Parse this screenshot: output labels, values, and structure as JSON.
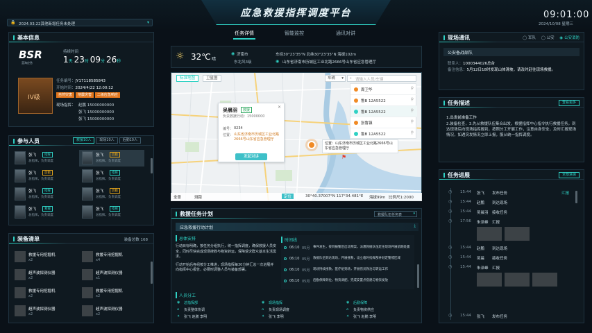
{
  "header": {
    "notice": "2024.03.22其他新增任务未处理",
    "title": "应急救援指挥调度平台",
    "time": "09:01:00",
    "date": "2024/10/08 星期三",
    "nav_tabs": [
      "任务详情",
      "智能监控",
      "通讯对讲"
    ]
  },
  "basic_info": {
    "title": "基本信息",
    "logo": "BSR",
    "logo_sub": "蓝海应急",
    "duration_label": "持续时间",
    "duration": {
      "d": "1",
      "d_unit": "天",
      "h": "23",
      "h_unit": "时",
      "m": "09",
      "m_unit": "分",
      "s": "26",
      "s_unit": "秒"
    },
    "level": "IV级",
    "task_id_label": "任务编号：",
    "task_id": "JY17118585843",
    "time_label": "开始时间：",
    "time_value": "2024/4/22 12:00:12",
    "tags": [
      "自然灾害",
      "地震灾害",
      "二级应急响应"
    ],
    "contact_label": "现场指挥：",
    "contacts": [
      "赵鹏 15000000000",
      "张飞 15000000000",
      "张飞 15000000000"
    ]
  },
  "personnel": {
    "title": "参与人员",
    "filters": [
      "救援10人",
      "现场10人",
      "后勤10人"
    ],
    "people": [
      {
        "name": "张飞",
        "tag": "指挥",
        "tag_color": "#2fd1c4",
        "desc": "总指挥，负责调度"
      },
      {
        "name": "张飞",
        "tag": "后勤",
        "tag_color": "#e0a21c",
        "desc": "总指挥，负责调度"
      },
      {
        "name": "张飞",
        "tag": "后勤",
        "tag_color": "#e0a21c",
        "desc": "总指挥，负责调度"
      },
      {
        "name": "张飞",
        "tag": "指挥",
        "tag_color": "#2fd1c4",
        "desc": "总指挥，负责调度"
      },
      {
        "name": "张飞",
        "tag": "指挥",
        "tag_color": "#2fd1c4",
        "desc": "总指挥，负责调度"
      },
      {
        "name": "张飞",
        "tag": "后勤",
        "tag_color": "#e0a21c",
        "desc": "总指挥，负责调度"
      },
      {
        "name": "张飞",
        "tag": "救援",
        "tag_color": "#2fd1c4",
        "desc": "总指挥，负责调度"
      },
      {
        "name": "张飞",
        "tag": "指挥",
        "tag_color": "#2fd1c4",
        "desc": "总指挥，负责调度"
      }
    ]
  },
  "equipment": {
    "title": "装备清单",
    "total_label": "装备总数 168",
    "items": [
      {
        "name": "救援专用挖掘机",
        "count": "x2"
      },
      {
        "name": "救援专用挖掘机",
        "count": "x4"
      },
      {
        "name": "超声波探测仪器",
        "count": "x2"
      },
      {
        "name": "超声波探测仪器",
        "count": "x1"
      },
      {
        "name": "救援专用挖掘机",
        "count": "x2"
      },
      {
        "name": "救援专用挖掘机",
        "count": "x2"
      },
      {
        "name": "超声波探测仪器",
        "count": "x2"
      },
      {
        "name": "超声波探测仪器",
        "count": "x2"
      }
    ]
  },
  "weather": {
    "temp": "32℃",
    "cond": "晴",
    "city": "济南市",
    "wind": "东北风3级",
    "coords": "东经30°23'35\"N  北纬30°23'35\"N  海拔102m",
    "address": "山东省济南市历城区工业北路2666号山东省应急管理厅"
  },
  "map": {
    "tabs": [
      "标准地图",
      "卫星图"
    ],
    "vehicle_label": "车辆",
    "search_placeholder": "请输入人员/车辆",
    "list": [
      {
        "name": "周卫华",
        "color": "#f08a24"
      },
      {
        "name": "鲁B 12A5522",
        "color": "#f08a24"
      },
      {
        "name": "鲁B 12A5522",
        "color": "#2fd1c4"
      },
      {
        "name": "张鲁镇",
        "color": "#f08a24"
      },
      {
        "name": "鲁B 12A5522",
        "color": "#2fd1c4"
      }
    ],
    "popup": {
      "name": "吴晨羽",
      "tag": "救援",
      "phone": "负责救援行动：15000000",
      "code_label": "编号：",
      "code": "0234",
      "loc_label": "位置：",
      "loc": "山东省济南市历城区工业北路2666号山东省应急管理厅",
      "btn": "发起对讲"
    },
    "label_box": "位置：山东济南市历城区工业北路2666号山东省应急管理厅",
    "bottom": {
      "all": "全景",
      "measure": "测距",
      "locate": "定位",
      "coord": "30°40.37007°N  117°34.481°E",
      "scale": "海拔99m",
      "zoom": "比例尺1:2000"
    }
  },
  "rescue_plan": {
    "title": "救援任务计划",
    "select": "救援队伍任务表",
    "subtitle": "应急救援行动计划",
    "sec1": "总体安排",
    "sec1_text1": "行动目标明确，按任务分组执行，统一指挥调度，确保救援人员安全，同时尽快完成现场搜救与物资转运，保障受灾群众基本生活需求。",
    "sec1_text2": "行动开始后各组按分工推进，现场指挥每30分钟汇总一次进展并向指挥中心报告，必要时调整人员与装备部署。",
    "sec2": "时间线",
    "timeline": [
      {
        "time": "06:10",
        "date": "05月",
        "text": "事件发生，接到报警后启动预案，派遣救援队伍赶往现场开展前期处置"
      },
      {
        "time": "06:10",
        "date": "05月",
        "text": "救援队伍到达现场，开展搜救，设立临时指挥部并划定警戒区域"
      },
      {
        "time": "06:10",
        "date": "05月",
        "text": "现场持续搜救，医疗组到场，开展伤员救治与转运工作"
      },
      {
        "time": "06:10",
        "date": "05月",
        "text": "后勤保障到位，物资调配，完成安置点搭建与物资发放"
      }
    ],
    "sec3": "人员分工",
    "roles": [
      [
        "总指挥部",
        "现场指挥",
        "后勤保障"
      ],
      [
        "负责整体协调",
        "负责现场调度",
        "负责物资供应"
      ],
      [
        "张飞 赵鹏 李明",
        "张飞 李明",
        "张飞 赵鹏 李明"
      ]
    ]
  },
  "site_comm": {
    "title": "现场通讯",
    "filters": [
      "军队",
      "公安",
      "公安消防"
    ],
    "sub": "公安备战部队",
    "caller_label": "联系人：",
    "caller": "1000344026总台",
    "content_label": "备注信息：",
    "content": "5月12日18时发现山体滑坡，请及时赶往现场救援。"
  },
  "task_desc": {
    "title": "任务描述",
    "btn": "查看更多",
    "text_title": "1.出发前准备工作",
    "text": "2.装备检查，3.先从救援队伍集合出发，根据指挥中心指令执行救援任务，到达现场后向现场指挥报到，按照分工开展工作，注意自身安全，及时汇报现场情况，如遇突发情况立即上报，服从统一指挥调度。"
  },
  "task_progress": {
    "title": "任务进展",
    "btn": "全部进展",
    "entries": [
      {
        "time": "15:44",
        "name": "张飞",
        "action": "发布任务",
        "right": "汇报"
      },
      {
        "time": "15:44",
        "name": "赵鹏",
        "action": "到达现场"
      },
      {
        "time": "15:44",
        "name": "吴晨羽",
        "action": "接收任务"
      },
      {
        "time": "17:56",
        "name": "朱泽峰",
        "action": "汇报"
      },
      {
        "time": "15:44",
        "name": "赵鹏",
        "action": "到达现场"
      },
      {
        "time": "15:44",
        "name": "吴晨",
        "action": "接收任务"
      },
      {
        "time": "15:44",
        "name": "朱泽峰",
        "action": "汇报"
      },
      {
        "time": "15:44",
        "name": "张飞",
        "action": "发布任务"
      }
    ]
  }
}
